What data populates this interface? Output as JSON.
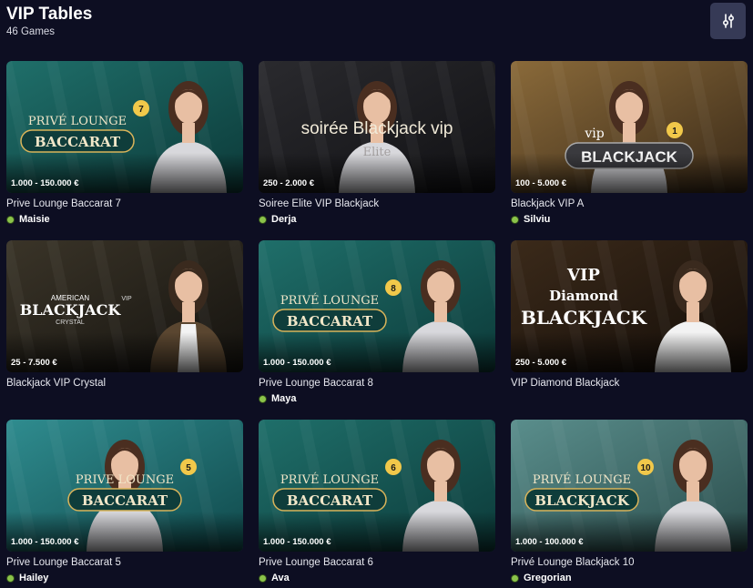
{
  "page": {
    "title": "VIP Tables",
    "games_count": "46 Games"
  },
  "colors": {
    "background": "#0d0e22",
    "filter_button": "#363a56",
    "online_dot": "#8bc34a",
    "teal": "#1d6e6a",
    "gold": "#d9b45a"
  },
  "filter_button": {
    "icon": "sliders-icon"
  },
  "games": [
    {
      "name": "Prive Lounge Baccarat 7",
      "limits": "1.000 - 150.000 €",
      "dealer": "Maisie",
      "art": {
        "logo_top": "PRIVÉ LOUNGE",
        "logo_main": "BACCARAT",
        "number": "7"
      }
    },
    {
      "name": "Soiree Elite VIP Blackjack",
      "limits": "250 - 2.000 €",
      "dealer": "Derja",
      "art": {
        "logo_top": "soirée Blackjack vip",
        "logo_main": "Elite"
      }
    },
    {
      "name": "Blackjack VIP A",
      "limits": "100 - 5.000 €",
      "dealer": "Silviu",
      "art": {
        "logo_top": "vip",
        "logo_main": "BLACKJACK",
        "number": "1"
      }
    },
    {
      "name": "Blackjack VIP Crystal",
      "limits": "25 - 7.500 €",
      "dealer": "",
      "art": {
        "logo_top": "AMERICAN",
        "logo_main": "BLACKJACK",
        "logo_sub": "CRYSTAL",
        "badge": "VIP"
      }
    },
    {
      "name": "Prive Lounge Baccarat 8",
      "limits": "1.000 - 150.000 €",
      "dealer": "Maya",
      "art": {
        "logo_top": "PRIVÉ LOUNGE",
        "logo_main": "BACCARAT",
        "number": "8"
      }
    },
    {
      "name": "VIP Diamond Blackjack",
      "limits": "250 - 5.000 €",
      "dealer": "",
      "art": {
        "logo_top": "VIP",
        "logo_main": "Diamond",
        "logo_sub": "BLACKJACK"
      }
    },
    {
      "name": "Prive Lounge Baccarat 5",
      "limits": "1.000 - 150.000 €",
      "dealer": "Hailey",
      "art": {
        "logo_top": "PRIVE LOUNGE",
        "logo_main": "BACCARAT",
        "number": "5"
      }
    },
    {
      "name": "Prive Lounge Baccarat 6",
      "limits": "1.000 - 150.000 €",
      "dealer": "Ava",
      "art": {
        "logo_top": "PRIVÉ LOUNGE",
        "logo_main": "BACCARAT",
        "number": "6"
      }
    },
    {
      "name": "Privé Lounge Blackjack 10",
      "limits": "1.000 - 100.000 €",
      "dealer": "Gregorian",
      "art": {
        "logo_top": "PRIVÉ LOUNGE",
        "logo_main": "BLACKJACK",
        "number": "10"
      }
    }
  ]
}
